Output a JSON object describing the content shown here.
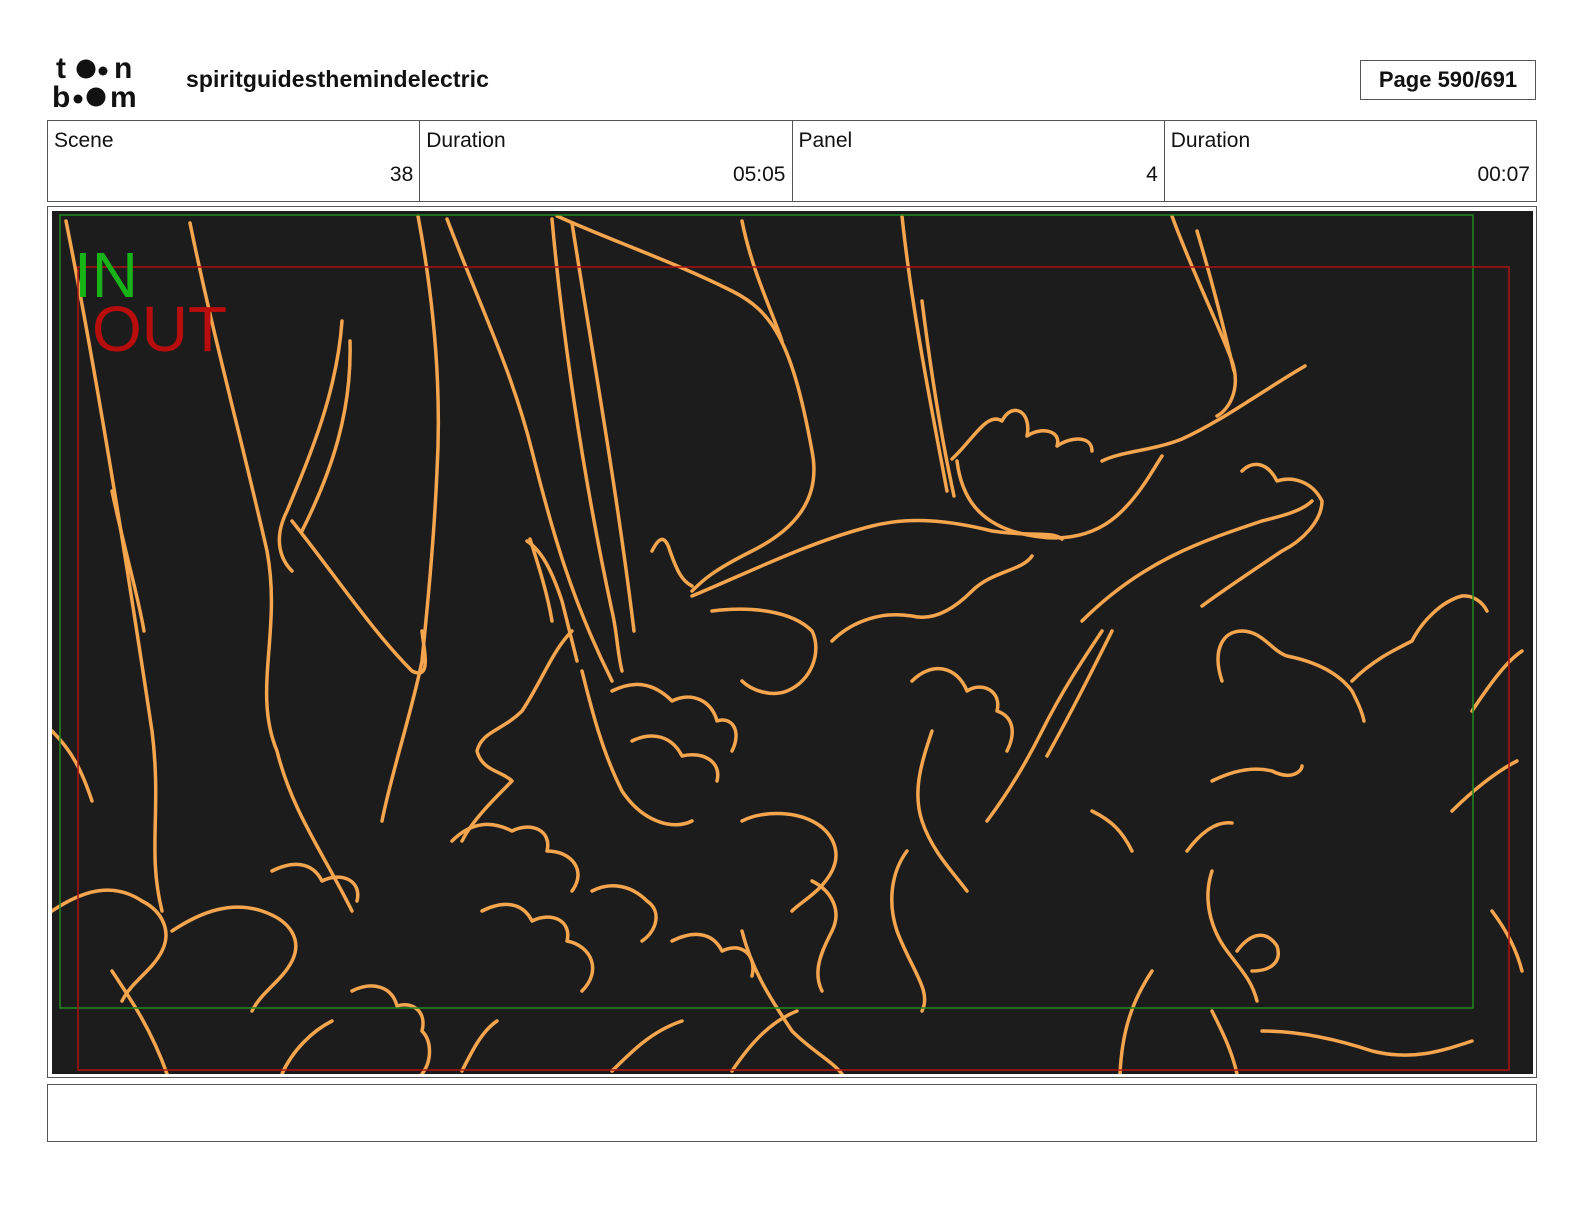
{
  "header": {
    "logo_alt": "toon boom",
    "project_title": "spiritguidesthemindelectric",
    "page_indicator": "Page 590/691"
  },
  "info_table": [
    {
      "label": "Scene",
      "value": "38"
    },
    {
      "label": "Duration",
      "value": "05:05"
    },
    {
      "label": "Panel",
      "value": "4"
    },
    {
      "label": "Duration",
      "value": "00:07"
    }
  ],
  "panel": {
    "in_label": "IN",
    "out_label": "OUT",
    "colors": {
      "background": "#1c1c1c",
      "sketch_line": "#f4a54d",
      "in_frame": "#1f8a1f",
      "in_text": "#17b317",
      "out_frame": "#b01010",
      "out_text": "#b80d0d"
    }
  },
  "notes": {
    "text": ""
  }
}
